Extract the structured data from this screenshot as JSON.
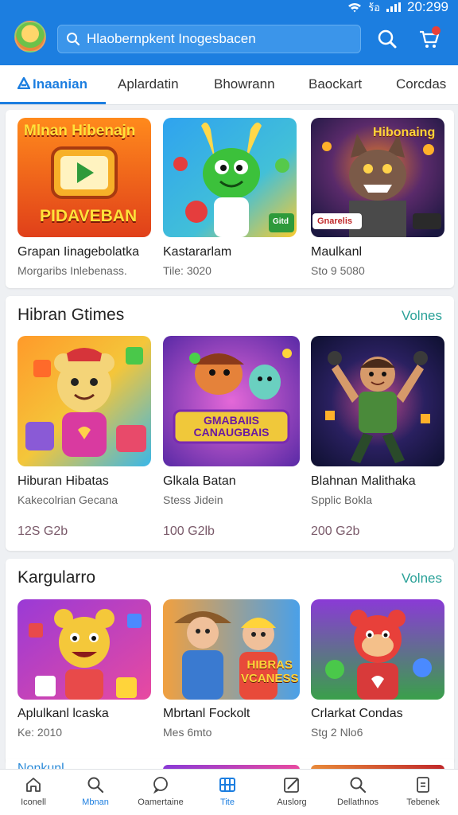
{
  "status_bar": {
    "time": "20:299",
    "carrier": "ร้อ"
  },
  "header": {
    "search_text": "Hlaobernpkent Inogesbacen"
  },
  "tabs": [
    {
      "label": "Inaanian",
      "active": true
    },
    {
      "label": "Aplardatin"
    },
    {
      "label": "Bhowrann"
    },
    {
      "label": "Baockart"
    },
    {
      "label": "Corcdas"
    }
  ],
  "featured": {
    "items": [
      {
        "name": "Grapan Iinagebolatka",
        "sub": "Morgaribs Inlebenass.",
        "art": {
          "title": "Mlnan Hibenajn",
          "caption": "PIDAVEBAN"
        }
      },
      {
        "name": "Kastararlam",
        "sub": "Tile: 3020",
        "art": {
          "badge": "Gitd"
        }
      },
      {
        "name": "Maulkanl",
        "sub": "Sto 9 5080",
        "art": {
          "title": "Hibonaing",
          "badge": "Gnarelis"
        }
      }
    ]
  },
  "section1": {
    "title": "Hibran Gtimes",
    "more": "Volnes",
    "items": [
      {
        "name": "Hiburan Hibatas",
        "sub": "Kakecolrian Gecana",
        "price": "12S G2b"
      },
      {
        "name": "Glkala Batan",
        "sub": "Stess Jidein",
        "price": "100 G2lb",
        "art": {
          "banner": "GMABAIIS\nCANAUGBAIS"
        }
      },
      {
        "name": "Blahnan Malithaka",
        "sub": "Spplic Bokla",
        "price": "200 G2b"
      }
    ]
  },
  "section2": {
    "title": "Kargularro",
    "more": "Volnes",
    "items": [
      {
        "name": "Aplulkanl lcaska",
        "sub": "Ke: 2010"
      },
      {
        "name": "Mbrtanl Fockolt",
        "sub": "Mes 6mto",
        "art": {
          "banner": "HIBRAS\nVCANESS"
        }
      },
      {
        "name": "Crlarkat Condas",
        "sub": "Stg 2 Nlo6"
      }
    ]
  },
  "peek": {
    "title": "Nonkunl"
  },
  "bottom_nav": [
    {
      "label": "Iconell"
    },
    {
      "label": "Mbnan",
      "active": true
    },
    {
      "label": "Oamertaine"
    },
    {
      "label": "Tite",
      "active": true
    },
    {
      "label": "Auslorg"
    },
    {
      "label": "Dellathnos"
    },
    {
      "label": "Tebenek"
    }
  ],
  "colors": {
    "primary": "#1c7ee0",
    "accent_link": "#2aa198",
    "cart_badge": "#e8403a"
  }
}
